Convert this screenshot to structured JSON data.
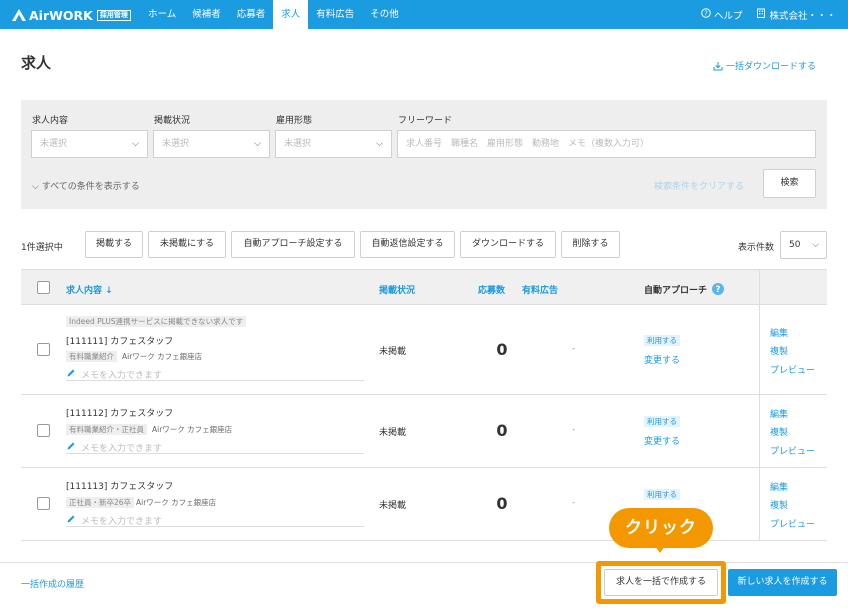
{
  "header": {
    "brand": "AirWORK",
    "brand_badge": "採用管理",
    "nav": [
      "ホーム",
      "候補者",
      "応募者",
      "求人",
      "有料広告",
      "その他"
    ],
    "active_nav": "求人",
    "help": "ヘルプ",
    "company": "株式会社・・・"
  },
  "page": {
    "title": "求人",
    "bulk_download": "一括ダウンロードする"
  },
  "filter": {
    "job_content_label": "求人内容",
    "job_content_value": "未選択",
    "posting_status_label": "掲載状況",
    "posting_status_value": "未選択",
    "employment_type_label": "雇用形態",
    "employment_type_value": "未選択",
    "freeword_label": "フリーワード",
    "freeword_placeholder": "求人番号　職種名　雇用形態　勤務地　メモ（複数入力可）",
    "show_all": "すべての条件を表示する",
    "clear": "検索条件をクリアする",
    "search": "検索"
  },
  "actions": {
    "selected": "1件選択中",
    "buttons": [
      "掲載する",
      "未掲載にする",
      "自動アプローチ設定する",
      "自動返信設定する",
      "ダウンロードする",
      "削除する"
    ],
    "per_page_label": "表示件数",
    "per_page_value": "50"
  },
  "table": {
    "headers": {
      "content": "求人内容",
      "status": "掲載状況",
      "applications": "応募数",
      "paid_ad": "有料広告",
      "auto_approach": "自動アプローチ"
    },
    "rows": [
      {
        "notice": "Indeed PLUS連携サービスに掲載できない求人です",
        "title": "[111111] カフェスタッフ",
        "tag": "有料職業紹介",
        "location": "Airワーク カフェ銀座店",
        "memo": "メモを入力できます",
        "status": "未掲載",
        "applications": "0",
        "paid_ad": "-",
        "approach_badge": "利用する",
        "approach_change": "変更する",
        "links": [
          "編集",
          "複製",
          "プレビュー"
        ]
      },
      {
        "title": "[111112] カフェスタッフ",
        "tag": "有料職業紹介・正社員",
        "location": "Airワーク カフェ銀座店",
        "memo": "メモを入力できます",
        "status": "未掲載",
        "applications": "0",
        "paid_ad": "-",
        "approach_badge": "利用する",
        "approach_change": "変更する",
        "links": [
          "編集",
          "複製",
          "プレビュー"
        ]
      },
      {
        "title": "[111113] カフェスタッフ",
        "tag": "正社員・新卒26卒",
        "location": "Airワーク カフェ銀座店",
        "memo": "メモを入力できます",
        "status": "未掲載",
        "applications": "0",
        "paid_ad": "-",
        "approach_badge": "利用する",
        "links": [
          "編集",
          "複製",
          "プレビュー"
        ]
      }
    ]
  },
  "footer": {
    "history": "一括作成の履歴",
    "bulk_create": "求人を一括で作成する",
    "new_job": "新しい求人を作成する"
  },
  "callout": "クリック",
  "colors": {
    "primary": "#1b9be0",
    "highlight": "#f39800"
  }
}
